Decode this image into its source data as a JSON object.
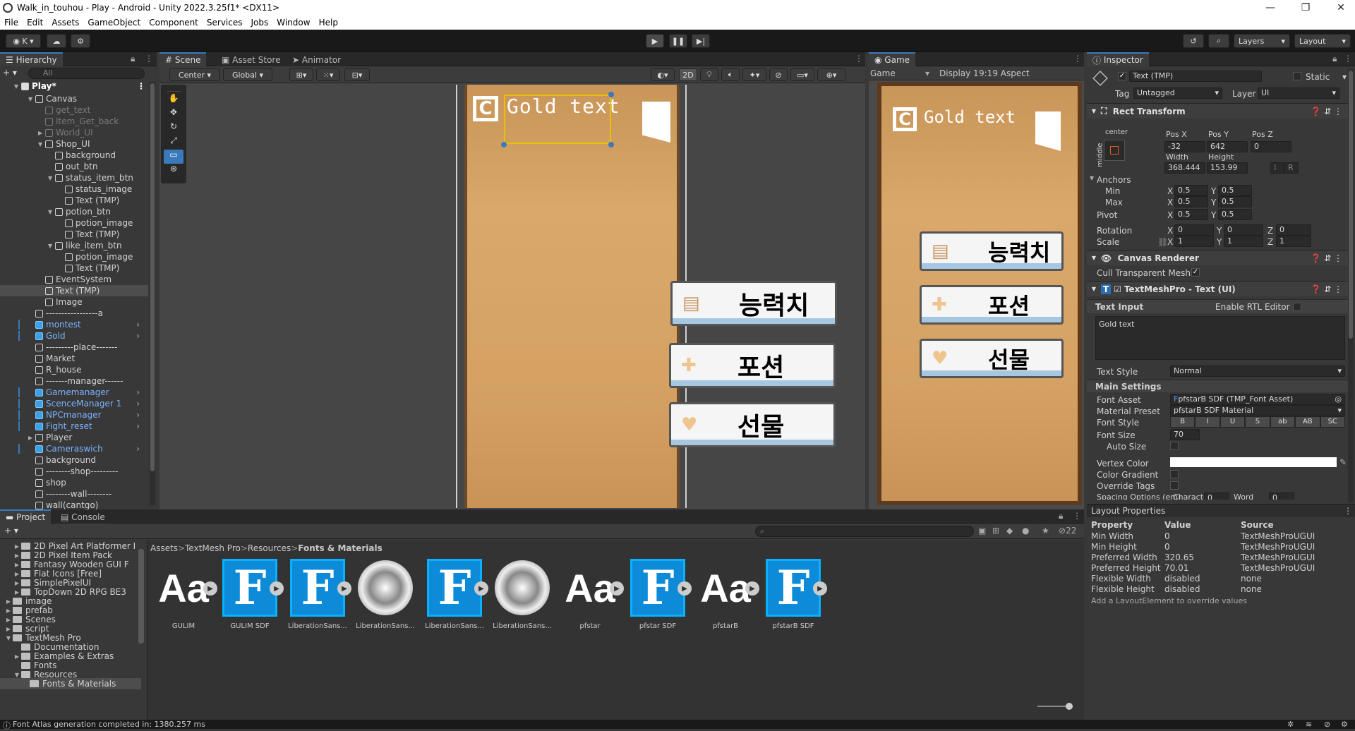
{
  "title": {
    "text": "Walk_in_touhou - Play - Android - Unity 2022.3.25f1* <DX11>"
  },
  "menu": [
    "File",
    "Edit",
    "Assets",
    "GameObject",
    "Component",
    "Services",
    "Jobs",
    "Window",
    "Help"
  ],
  "toolbar": {
    "account": "K",
    "layers": "Layers",
    "layout": "Layout"
  },
  "hierarchy": {
    "tab": "Hierarchy",
    "search_placeholder": "All",
    "scene": "Play*",
    "rows": [
      {
        "t": "Canvas",
        "d": 1,
        "a": "▼",
        "c": "w"
      },
      {
        "t": "get_text",
        "d": 2,
        "a": "",
        "c": "dim"
      },
      {
        "t": "Item_Get_back",
        "d": 2,
        "a": "",
        "c": "dim"
      },
      {
        "t": "World_UI",
        "d": 2,
        "a": "▶",
        "c": "dim"
      },
      {
        "t": "Shop_UI",
        "d": 2,
        "a": "▼",
        "c": "w"
      },
      {
        "t": "background",
        "d": 3,
        "a": "",
        "c": "w"
      },
      {
        "t": "out_btn",
        "d": 3,
        "a": "",
        "c": "w"
      },
      {
        "t": "status_item_btn",
        "d": 3,
        "a": "▼",
        "c": "w"
      },
      {
        "t": "status_image",
        "d": 4,
        "a": "",
        "c": "w"
      },
      {
        "t": "Text (TMP)",
        "d": 4,
        "a": "",
        "c": "w"
      },
      {
        "t": "potion_btn",
        "d": 3,
        "a": "▼",
        "c": "w"
      },
      {
        "t": "potion_image",
        "d": 4,
        "a": "",
        "c": "w"
      },
      {
        "t": "Text (TMP)",
        "d": 4,
        "a": "",
        "c": "w"
      },
      {
        "t": "like_item_btn",
        "d": 3,
        "a": "▼",
        "c": "w"
      },
      {
        "t": "potion_image",
        "d": 4,
        "a": "",
        "c": "w"
      },
      {
        "t": "Text (TMP)",
        "d": 4,
        "a": "",
        "c": "w"
      },
      {
        "t": "EventSystem",
        "d": 2,
        "a": "",
        "c": "w"
      },
      {
        "t": "Text (TMP)",
        "d": 2,
        "a": "",
        "c": "sel"
      },
      {
        "t": "Image",
        "d": 2,
        "a": "",
        "c": "w"
      },
      {
        "t": "-----------------a",
        "d": 1,
        "a": "",
        "c": "w"
      },
      {
        "t": "montest",
        "d": 1,
        "a": "",
        "c": "blue"
      },
      {
        "t": "Gold",
        "d": 1,
        "a": "",
        "c": "blue"
      },
      {
        "t": "---------place-------",
        "d": 1,
        "a": "",
        "c": "w"
      },
      {
        "t": "Market",
        "d": 1,
        "a": "",
        "c": "w"
      },
      {
        "t": "R_house",
        "d": 1,
        "a": "",
        "c": "w"
      },
      {
        "t": "-------manager------",
        "d": 1,
        "a": "",
        "c": "w"
      },
      {
        "t": "Gamemanager",
        "d": 1,
        "a": "",
        "c": "blue"
      },
      {
        "t": "ScenceManager 1",
        "d": 1,
        "a": "",
        "c": "blue"
      },
      {
        "t": "NPCmanager",
        "d": 1,
        "a": "",
        "c": "blue"
      },
      {
        "t": "Fight_reset",
        "d": 1,
        "a": "",
        "c": "blue"
      },
      {
        "t": "Player",
        "d": 1,
        "a": "▶",
        "c": "w"
      },
      {
        "t": "Cameraswich",
        "d": 1,
        "a": "",
        "c": "blue"
      },
      {
        "t": "background",
        "d": 1,
        "a": "",
        "c": "w"
      },
      {
        "t": "--------shop---------",
        "d": 1,
        "a": "",
        "c": "w"
      },
      {
        "t": "shop",
        "d": 1,
        "a": "",
        "c": "w"
      },
      {
        "t": "--------wall--------",
        "d": 1,
        "a": "",
        "c": "w"
      },
      {
        "t": "wall(cantgo)",
        "d": 1,
        "a": "",
        "c": "w"
      }
    ]
  },
  "scene": {
    "tabs": [
      "Scene",
      "Asset Store",
      "Animator"
    ],
    "center": "Center",
    "global": "Global",
    "mode2d": "2D"
  },
  "game_ui": {
    "gold_text": "Gold text",
    "btn1": "능력치",
    "btn2": "포션",
    "btn3": "선물"
  },
  "game": {
    "tab": "Game",
    "mode": "Game",
    "display": "Display 1",
    "aspect": "9:19 Aspect"
  },
  "inspector": {
    "tab": "Inspector",
    "object_name": "Text (TMP)",
    "static": "Static",
    "tag_label": "Tag",
    "tag": "Untagged",
    "layer_label": "Layer",
    "layer": "UI",
    "rect_transform": "Rect Transform",
    "anchor_h": "center",
    "anchor_v": "middle",
    "pos_x_label": "Pos X",
    "pos_y_label": "Pos Y",
    "pos_z_label": "Pos Z",
    "pos_x": "-32",
    "pos_y": "642",
    "pos_z": "0",
    "width_label": "Width",
    "height_label": "Height",
    "width": "368.444",
    "height": "153.99",
    "r_btn": "R",
    "anchors": "Anchors",
    "min": "Min",
    "max": "Max",
    "pivot": "Pivot",
    "rotation": "Rotation",
    "scale": "Scale",
    "x": "X",
    "y": "Y",
    "z": "Z",
    "anchor_min_x": "0.5",
    "anchor_min_y": "0.5",
    "anchor_max_x": "0.5",
    "anchor_max_y": "0.5",
    "pivot_x": "0.5",
    "pivot_y": "0.5",
    "rot_x": "0",
    "rot_y": "0",
    "rot_z": "0",
    "scale_x": "1",
    "scale_y": "1",
    "scale_z": "1",
    "canvas_renderer": "Canvas Renderer",
    "cull": "Cull Transparent Mesh",
    "tmp": "TextMeshPro - Text (UI)",
    "text_input": "Text Input",
    "rtl": "Enable RTL Editor",
    "text_value": "Gold text",
    "text_style_label": "Text Style",
    "text_style": "Normal",
    "main_settings": "Main Settings",
    "font_asset_label": "Font Asset",
    "font_asset": "pfstarB SDF (TMP_Font Asset)",
    "material_preset_label": "Material Preset",
    "material_preset": "pfstarB SDF Material",
    "font_style_label": "Font Style",
    "font_styles": [
      "B",
      "I",
      "U",
      "S",
      "ab",
      "AB",
      "SC"
    ],
    "font_size_label": "Font Size",
    "font_size": "70",
    "auto_size": "Auto Size",
    "vertex_color": "Vertex Color",
    "color_gradient": "Color Gradient",
    "override_tags": "Override Tags",
    "spacing": "Spacing Options (em)",
    "character": "Character",
    "character_val": "0",
    "word": "Word",
    "word_val": "0"
  },
  "layout_props": {
    "title": "Layout Properties",
    "headers": [
      "Property",
      "Value",
      "Source"
    ],
    "rows": [
      [
        "Min Width",
        "0",
        "TextMeshProUGUI"
      ],
      [
        "Min Height",
        "0",
        "TextMeshProUGUI"
      ],
      [
        "Preferred Width",
        "320.65",
        "TextMeshProUGUI"
      ],
      [
        "Preferred Height",
        "70.01",
        "TextMeshProUGUI"
      ],
      [
        "Flexible Width",
        "disabled",
        "none"
      ],
      [
        "Flexible Height",
        "disabled",
        "none"
      ]
    ],
    "footer": "Add a LayoutElement to override values"
  },
  "project": {
    "tabs": [
      "Project",
      "Console"
    ],
    "tree": [
      {
        "t": "2D Pixel Art Platformer I",
        "d": 1,
        "a": "▶"
      },
      {
        "t": "2D Pixel Item Pack",
        "d": 1,
        "a": "▶"
      },
      {
        "t": "Fantasy Wooden GUI  F",
        "d": 1,
        "a": "▶"
      },
      {
        "t": "Flat Icons [Free]",
        "d": 1,
        "a": "▶"
      },
      {
        "t": "SimplePixelUI",
        "d": 1,
        "a": "▶"
      },
      {
        "t": "TopDown 2D RPG BE3",
        "d": 1,
        "a": "▶"
      },
      {
        "t": "image",
        "d": 0,
        "a": "▶"
      },
      {
        "t": "prefab",
        "d": 0,
        "a": "▶"
      },
      {
        "t": "Scenes",
        "d": 0,
        "a": "▶"
      },
      {
        "t": "script",
        "d": 0,
        "a": "▶"
      },
      {
        "t": "TextMesh Pro",
        "d": 0,
        "a": "▼"
      },
      {
        "t": "Documentation",
        "d": 1,
        "a": ""
      },
      {
        "t": "Examples & Extras",
        "d": 1,
        "a": "▶"
      },
      {
        "t": "Fonts",
        "d": 1,
        "a": ""
      },
      {
        "t": "Resources",
        "d": 1,
        "a": "▼"
      },
      {
        "t": "Fonts & Materials",
        "d": 2,
        "a": ""
      }
    ],
    "breadcrumb": [
      "Assets",
      "TextMesh Pro",
      "Resources",
      "Fonts & Materials"
    ],
    "count": "22",
    "assets": [
      {
        "n": "GULIM",
        "k": "aa"
      },
      {
        "n": "GULIM SDF",
        "k": "f"
      },
      {
        "n": "LiberationSans...",
        "k": "f"
      },
      {
        "n": "LiberationSans...",
        "k": "tex"
      },
      {
        "n": "LiberationSans...",
        "k": "f"
      },
      {
        "n": "LiberationSans...",
        "k": "tex"
      },
      {
        "n": "pfstar",
        "k": "aa"
      },
      {
        "n": "pfstar SDF",
        "k": "f"
      },
      {
        "n": "pfstarB",
        "k": "aa"
      },
      {
        "n": "pfstarB SDF",
        "k": "f"
      }
    ]
  },
  "status": {
    "text": "Font Atlas generation completed in: 1380.257 ms"
  }
}
